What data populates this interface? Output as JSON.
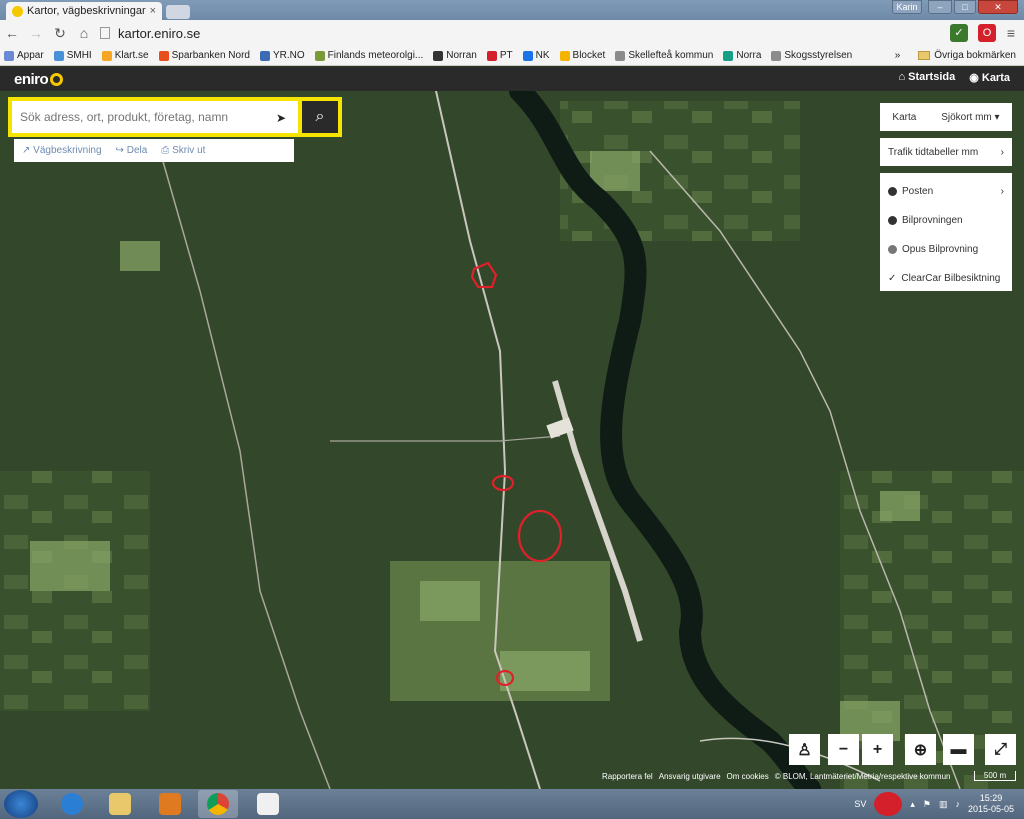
{
  "browser": {
    "tab_title": "Kartor, vägbeskrivningar",
    "tab_close": "×",
    "url": "kartor.eniro.se",
    "user_label": "Karin",
    "bookmarks": [
      "Appar",
      "SMHI",
      "Klart.se",
      "Sparbanken Nord",
      "YR.NO",
      "Finlands meteorolgi...",
      "Norran",
      "PT",
      "NK",
      "Blocket",
      "Skellefteå kommun",
      "Norra",
      "Skogsstyrelsen"
    ],
    "bookmark_colors": [
      "#6a8ad6",
      "#4a90d9",
      "#f5a623",
      "#e94e1b",
      "#3d6bb3",
      "#7a9a3a",
      "#333333",
      "#d4202a",
      "#1a73e8",
      "#f4b400",
      "#8b8b8b",
      "#16a085",
      "#8b8b8b"
    ],
    "bookmarks_more": "»",
    "other_bookmarks": "Övriga bokmärken"
  },
  "eniro": {
    "logo": "eniro",
    "nav_home": "Startsida",
    "nav_map": "Karta",
    "search_placeholder": "Sök adress, ort, produkt, företag, namn",
    "actions": [
      "Vägbeskrivning",
      "Dela",
      "Skriv ut"
    ],
    "map_type_a": "Karta",
    "map_type_b": "Sjökort mm",
    "trafik": "Trafik tidtabeller mm",
    "poi_items": [
      "Posten",
      "Bilprovningen",
      "Opus Bilprovning",
      "ClearCar Bilbesiktning"
    ],
    "attribution": [
      "Rapportera fel",
      "Ansvarig utgivare",
      "Om cookies",
      "© BLOM, Lantmäteriet/Metria/respektive kommun"
    ],
    "scale": "500 m"
  },
  "map_controls": [
    "person-icon",
    "zoom-out",
    "zoom-in",
    "locate-icon",
    "ruler-icon",
    "fullscreen-icon"
  ],
  "taskbar": {
    "lang": "SV",
    "time": "15:29",
    "date": "2015-05-05"
  }
}
